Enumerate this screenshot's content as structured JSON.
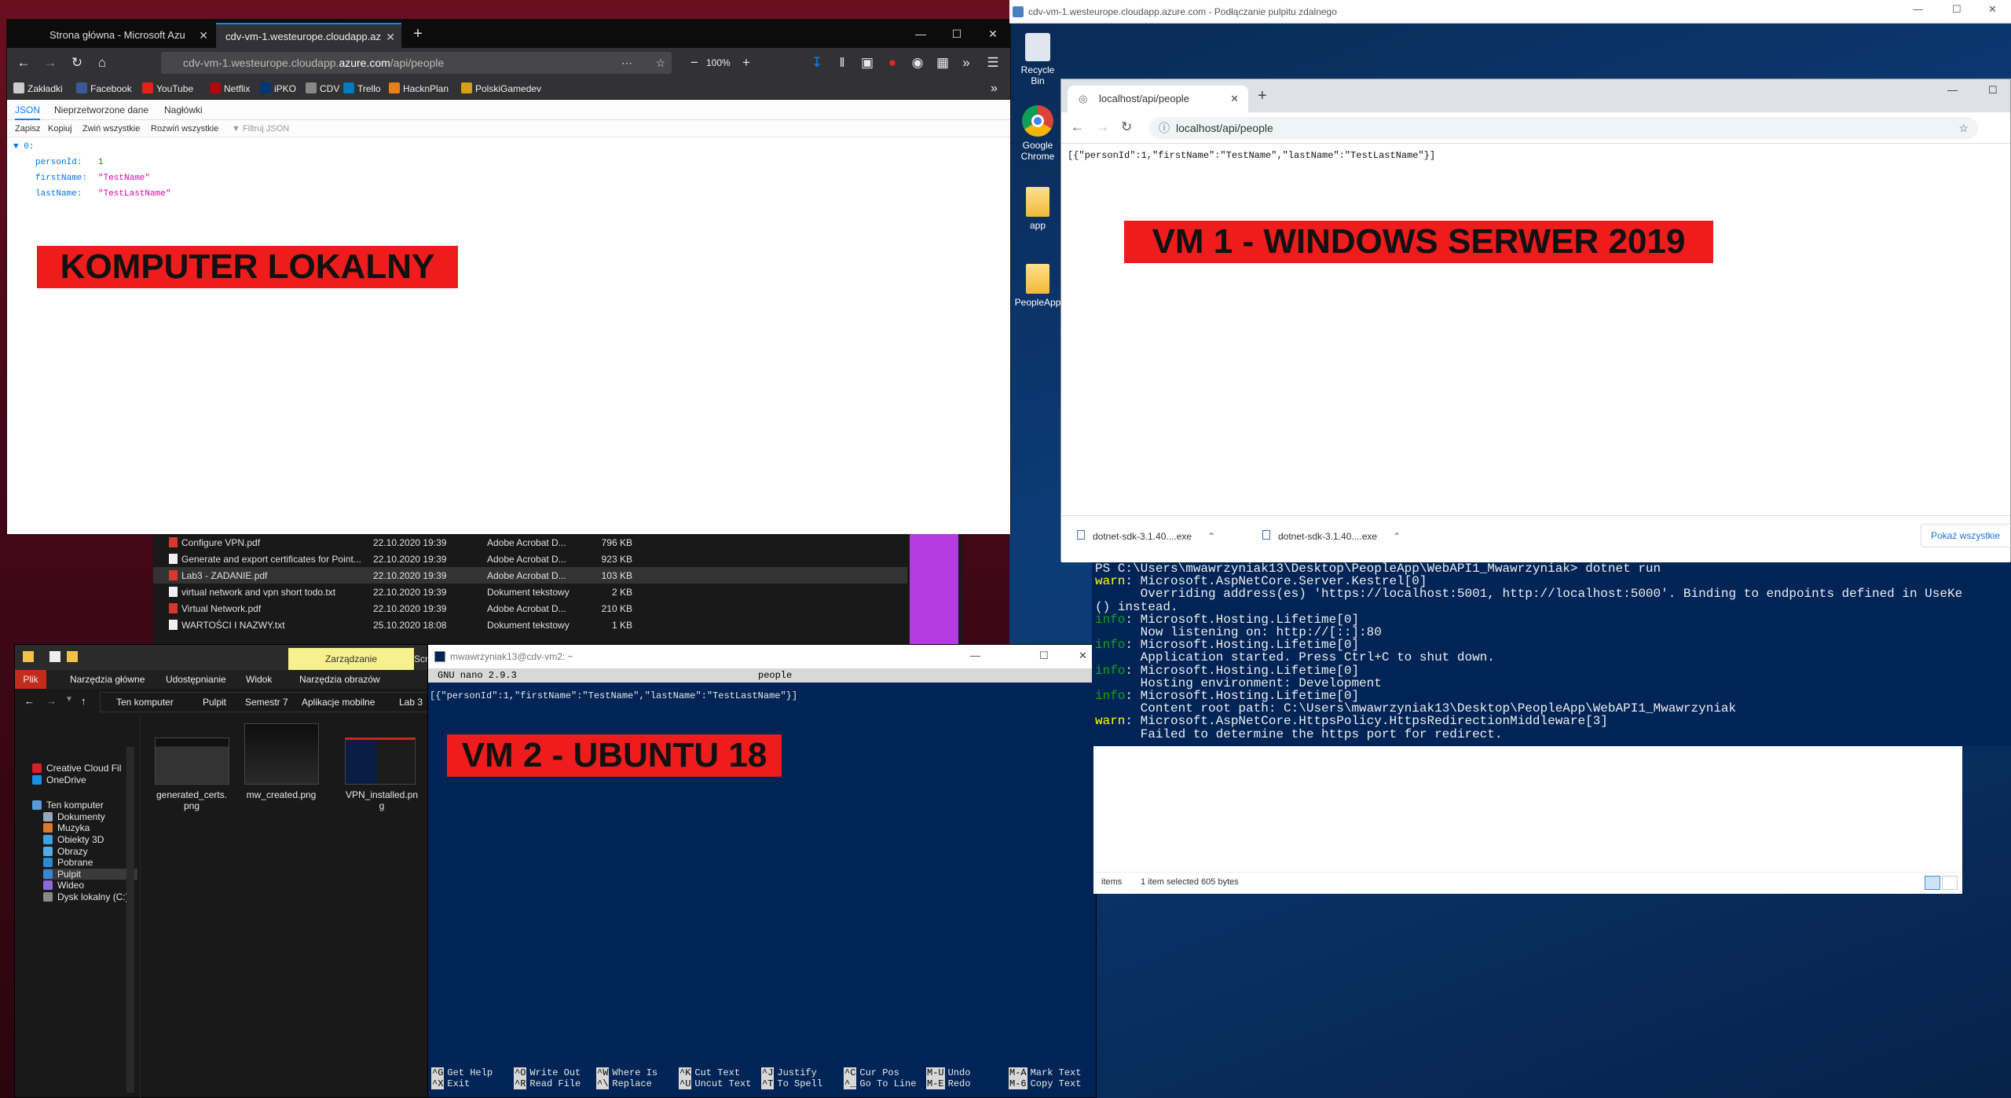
{
  "firefox": {
    "tabs": [
      {
        "label": "Strona główna - Microsoft Azu",
        "close": "✕"
      },
      {
        "label": "cdv-vm-1.westeurope.cloudapp.az",
        "close": "✕"
      }
    ],
    "new_tab": "+",
    "url_prefix": "cdv-vm-1.westeurope.cloudapp.",
    "url_domain": "azure.com",
    "url_path": "/api/people",
    "zoom": "100%",
    "bookmarks": [
      "Zakładki",
      "Facebook",
      "YouTube",
      "Netflix",
      "iPKO",
      "CDV",
      "Trello",
      "HacknPlan",
      "PolskiGamedev"
    ],
    "viewer_tabs": [
      "JSON",
      "Nieprzetworzone dane",
      "Nagłówki"
    ],
    "toolbar": [
      "Zapisz",
      "Kopiuj",
      "Zwiń wszystkie",
      "Rozwiń wszystkie"
    ],
    "filter_placeholder": "Filtruj JSON",
    "json": {
      "index": "0:",
      "rows": [
        {
          "key": "personId:",
          "value": "1"
        },
        {
          "key": "firstName:",
          "value": "\"TestName\""
        },
        {
          "key": "lastName:",
          "value": "\"TestLastName\""
        }
      ]
    },
    "banner": "KOMPUTER LOKALNY"
  },
  "explorer_back": {
    "files": [
      {
        "name": "Configure VPN.pdf",
        "date": "22.10.2020 19:39",
        "type": "Adobe Acrobat D...",
        "size": "796 KB"
      },
      {
        "name": "Generate and export certificates for Point...",
        "date": "22.10.2020 19:39",
        "type": "Adobe Acrobat D...",
        "size": "923 KB"
      },
      {
        "name": "Lab3 - ZADANIE.pdf",
        "date": "22.10.2020 19:39",
        "type": "Adobe Acrobat D...",
        "size": "103 KB"
      },
      {
        "name": "virtual network and vpn short todo.txt",
        "date": "22.10.2020 19:39",
        "type": "Dokument tekstowy",
        "size": "2 KB"
      },
      {
        "name": "Virtual Network.pdf",
        "date": "22.10.2020 19:39",
        "type": "Adobe Acrobat D...",
        "size": "210 KB"
      },
      {
        "name": "WARTOŚCI I NAZWY.txt",
        "date": "25.10.2020 18:08",
        "type": "Dokument tekstowy",
        "size": "1 KB"
      }
    ]
  },
  "explorer": {
    "context_tab": "Zarządzanie",
    "context_tab2": "Screen",
    "ribbon": [
      "Plik",
      "Narzędzia główne",
      "Udostępnianie",
      "Widok",
      "Narzędzia obrazów"
    ],
    "breadcrumb": [
      "Ten komputer",
      "Pulpit",
      "Semestr 7",
      "Aplikacje mobilne",
      "Lab 3"
    ],
    "thumbnails": [
      {
        "label": "generated_certs.\npng"
      },
      {
        "label": "mw_created.png"
      },
      {
        "label": "VPN_installed.pn\ng"
      }
    ],
    "nav": [
      "Creative Cloud Fil",
      "OneDrive",
      "Ten komputer",
      "Dokumenty",
      "Muzyka",
      "Obiekty 3D",
      "Obrazy",
      "Pobrane",
      "Pulpit",
      "Wideo",
      "Dysk lokalny (C:)"
    ]
  },
  "terminal": {
    "title": "mwawrzyniak13@cdv-vm2: ~",
    "nano_version": "GNU nano 2.9.3",
    "nano_file": "people",
    "content": "[{\"personId\":1,\"firstName\":\"TestName\",\"lastName\":\"TestLastName\"}]",
    "shortcuts": [
      {
        "k1": "^G",
        "l1": "Get Help",
        "k2": "^X",
        "l2": "Exit"
      },
      {
        "k1": "^O",
        "l1": "Write Out",
        "k2": "^R",
        "l2": "Read File"
      },
      {
        "k1": "^W",
        "l1": "Where Is",
        "k2": "^\\",
        "l2": "Replace"
      },
      {
        "k1": "^K",
        "l1": "Cut Text",
        "k2": "^U",
        "l2": "Uncut Text"
      },
      {
        "k1": "^J",
        "l1": "Justify",
        "k2": "^T",
        "l2": "To Spell"
      },
      {
        "k1": "^C",
        "l1": "Cur Pos",
        "k2": "^_",
        "l2": "Go To Line"
      },
      {
        "k1": "M-U",
        "l1": "Undo",
        "k2": "M-E",
        "l2": "Redo"
      },
      {
        "k1": "M-A",
        "l1": "Mark Text",
        "k2": "M-6",
        "l2": "Copy Text"
      }
    ],
    "banner": "VM 2 - UBUNTU 18"
  },
  "rdp": {
    "title": "cdv-vm-1.westeurope.cloudapp.azure.com - Podłączanie pulpitu zdalnego",
    "desktop_icons": [
      "Recycle Bin",
      "Google Chrome",
      "app",
      "PeopleApp"
    ],
    "chrome": {
      "tab": "localhost/api/people",
      "url": "localhost/api/people",
      "content": "[{\"personId\":1,\"firstName\":\"TestName\",\"lastName\":\"TestLastName\"}]",
      "downloads": [
        "dotnet-sdk-3.1.40....exe",
        "dotnet-sdk-3.1.40....exe"
      ],
      "show_all": "Pokaż wszystkie"
    },
    "banner": "VM 1 - WINDOWS SERWER 2019",
    "powershell": [
      {
        "p": "",
        "t": "PS C:\\Users\\mwawrzyniak13\\Desktop\\PeopleApp\\WebAPI1_Mwawrzyniak> dotnet run"
      },
      {
        "p": "warn",
        "t": ": Microsoft.AspNetCore.Server.Kestrel[0]"
      },
      {
        "p": "",
        "t": "      Overriding address(es) 'https://localhost:5001, http://localhost:5000'. Binding to endpoints defined in UseKe"
      },
      {
        "p": "",
        "t": "() instead."
      },
      {
        "p": "info",
        "t": ": Microsoft.Hosting.Lifetime[0]"
      },
      {
        "p": "",
        "t": "      Now listening on: http://[::]:80"
      },
      {
        "p": "info",
        "t": ": Microsoft.Hosting.Lifetime[0]"
      },
      {
        "p": "",
        "t": "      Application started. Press Ctrl+C to shut down."
      },
      {
        "p": "info",
        "t": ": Microsoft.Hosting.Lifetime[0]"
      },
      {
        "p": "",
        "t": "      Hosting environment: Development"
      },
      {
        "p": "info",
        "t": ": Microsoft.Hosting.Lifetime[0]"
      },
      {
        "p": "",
        "t": "      Content root path: C:\\Users\\mwawrzyniak13\\Desktop\\PeopleApp\\WebAPI1_Mwawrzyniak"
      },
      {
        "p": "warn",
        "t": ": Microsoft.AspNetCore.HttpsPolicy.HttpsRedirectionMiddleware[3]"
      },
      {
        "p": "",
        "t": "      Failed to determine the https port for redirect."
      }
    ],
    "status_items": "items",
    "status_selected": "1 item selected  605 bytes"
  },
  "colors": {
    "banner": "#ee1c1c",
    "ps_bg": "#012456",
    "firefox_dark": "#323234",
    "json_key": "#0074e8",
    "json_string": "#dd00a9",
    "json_number": "#058b00"
  }
}
